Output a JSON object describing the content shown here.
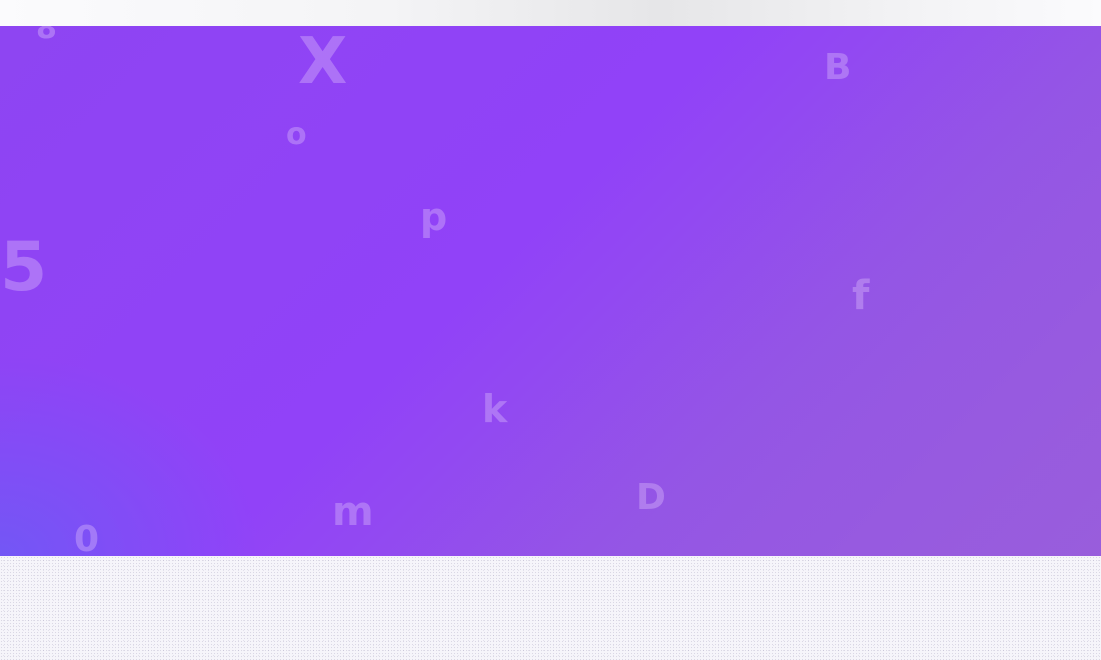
{
  "hero": {
    "background_colors": [
      "#8e45f2",
      "#9142f8",
      "#9a5fdc"
    ],
    "accent_corner_color": "#6e5af5",
    "glyphs": {
      "g1": "8",
      "g2": "X",
      "g3": "o",
      "g4": "B",
      "g5": "p",
      "g6": "5",
      "g7": "f",
      "g8": "k",
      "g9": "D",
      "g10": "m",
      "g11": "0"
    }
  },
  "page": {
    "background_color": "#f6f5fa"
  }
}
